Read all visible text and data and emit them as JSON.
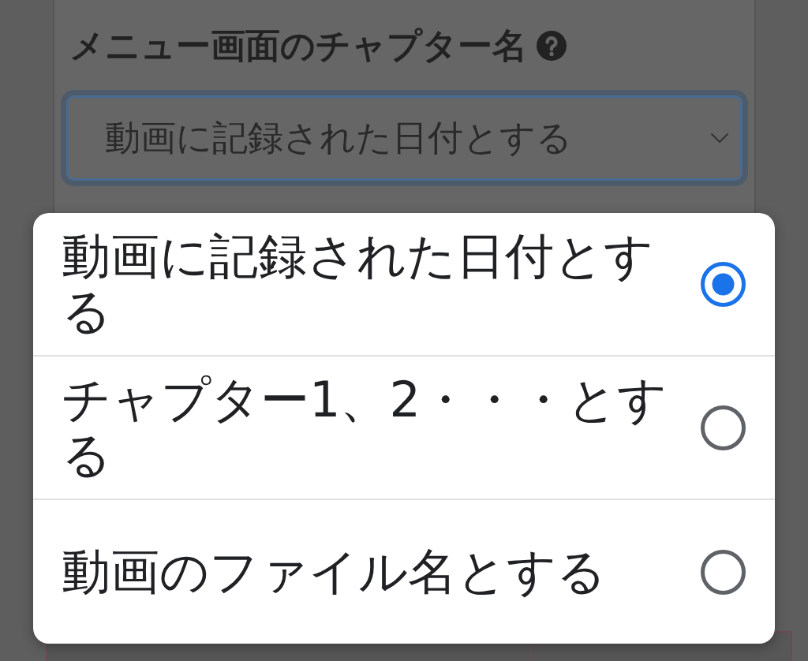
{
  "form": {
    "field_label": "メニュー画面のチャプター名",
    "select": {
      "value": "動画に記録された日付とする",
      "focused": true
    }
  },
  "dialog": {
    "options": [
      {
        "label": "動画に記録された日付とする",
        "selected": true
      },
      {
        "label": "チャプター1、2・・・とする",
        "selected": false
      },
      {
        "label": "動画のファイル名とする",
        "selected": false
      }
    ]
  }
}
